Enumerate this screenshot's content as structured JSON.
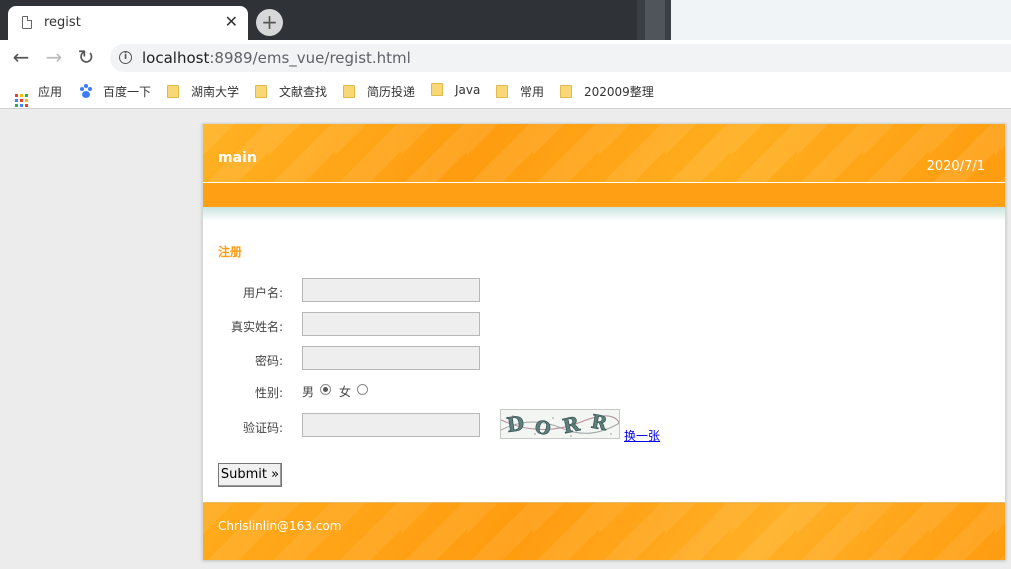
{
  "browser": {
    "tab_title": "regist",
    "url_host": "localhost",
    "url_rest": ":8989/ems_vue/regist.html"
  },
  "bookmarks": [
    {
      "label": "应用",
      "icon": "apps-grid-icon"
    },
    {
      "label": "百度一下",
      "icon": "baidu-paw-icon"
    },
    {
      "label": "湖南大学",
      "icon": "folder-icon"
    },
    {
      "label": "文献查找",
      "icon": "folder-icon"
    },
    {
      "label": "简历投递",
      "icon": "folder-icon"
    },
    {
      "label": "Java",
      "icon": "folder-icon"
    },
    {
      "label": "常用",
      "icon": "folder-icon"
    },
    {
      "label": "202009整理",
      "icon": "folder-icon"
    }
  ],
  "header": {
    "logo": "main",
    "date": "2020/7/1"
  },
  "form": {
    "title": "注册",
    "username_label": "用户名:",
    "realname_label": "真实姓名:",
    "password_label": "密码:",
    "gender_label": "性别:",
    "gender_male": "男",
    "gender_female": "女",
    "gender_selected": "男",
    "captcha_label": "验证码:",
    "captcha_text": "DORR",
    "refresh_link": "换一张",
    "submit_label": "Submit »"
  },
  "footer": {
    "email": "Chrislinlin@163.com"
  },
  "colors": {
    "accent": "#ff9c10",
    "link": "#0000ee"
  }
}
